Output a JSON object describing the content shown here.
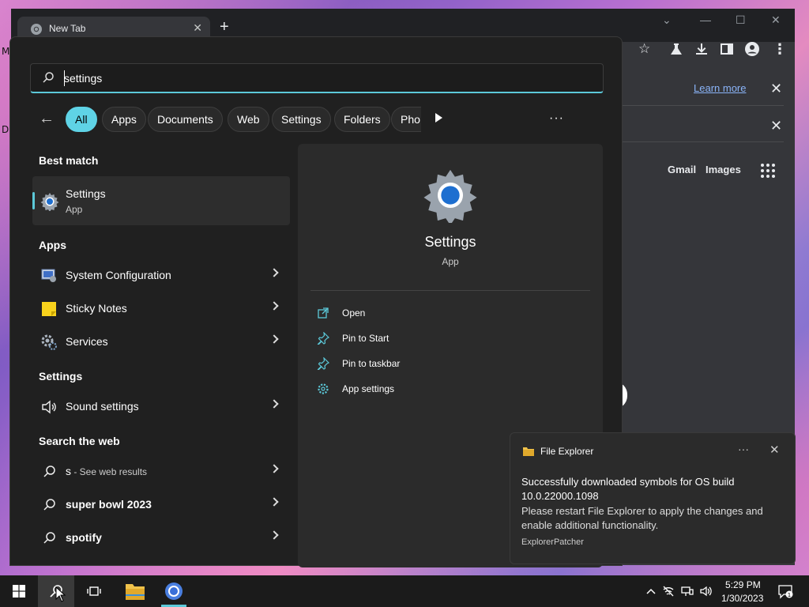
{
  "desktop": {
    "edge_letters": [
      "M",
      "D"
    ]
  },
  "browser": {
    "tab_title": "New Tab",
    "infobar_link": "Learn more",
    "header_links": [
      "Gmail",
      "Images"
    ]
  },
  "search": {
    "query": "settings",
    "filters": [
      "All",
      "Apps",
      "Documents",
      "Web",
      "Settings",
      "Folders",
      "Pho"
    ],
    "active_filter": "All",
    "best_match_heading": "Best match",
    "best_match": {
      "label": "Settings",
      "sub": "App",
      "icon": "settings-gear-icon"
    },
    "apps_heading": "Apps",
    "apps": [
      {
        "label": "System Configuration",
        "icon": "system-config-icon"
      },
      {
        "label": "Sticky Notes",
        "icon": "sticky-notes-icon"
      },
      {
        "label": "Services",
        "icon": "services-gear-icon"
      }
    ],
    "settings_heading": "Settings",
    "settings": [
      {
        "label": "Sound settings",
        "icon": "speaker-icon"
      }
    ],
    "web_heading": "Search the web",
    "web": [
      {
        "label": "s",
        "suffix": " - See web results"
      },
      {
        "label": "super bowl 2023",
        "suffix": ""
      },
      {
        "label": "spotify",
        "suffix": ""
      }
    ]
  },
  "preview": {
    "title": "Settings",
    "sub": "App",
    "actions": [
      {
        "label": "Open",
        "icon": "open-external-icon"
      },
      {
        "label": "Pin to Start",
        "icon": "pin-icon"
      },
      {
        "label": "Pin to taskbar",
        "icon": "pin-icon"
      },
      {
        "label": "App settings",
        "icon": "gear-icon"
      }
    ]
  },
  "toast": {
    "app": "File Explorer",
    "headline": "Successfully downloaded symbols for OS build 10.0.22000.1098",
    "body": "Please restart File Explorer to apply the changes and enable additional functionality.",
    "attribution": "ExplorerPatcher"
  },
  "taskbar": {
    "time": "5:29 PM",
    "date": "1/30/2023"
  },
  "colors": {
    "accent": "#5cc9d9",
    "panel_bg": "#202020",
    "preview_bg": "#2b2b2b",
    "link": "#8ab4f8"
  }
}
